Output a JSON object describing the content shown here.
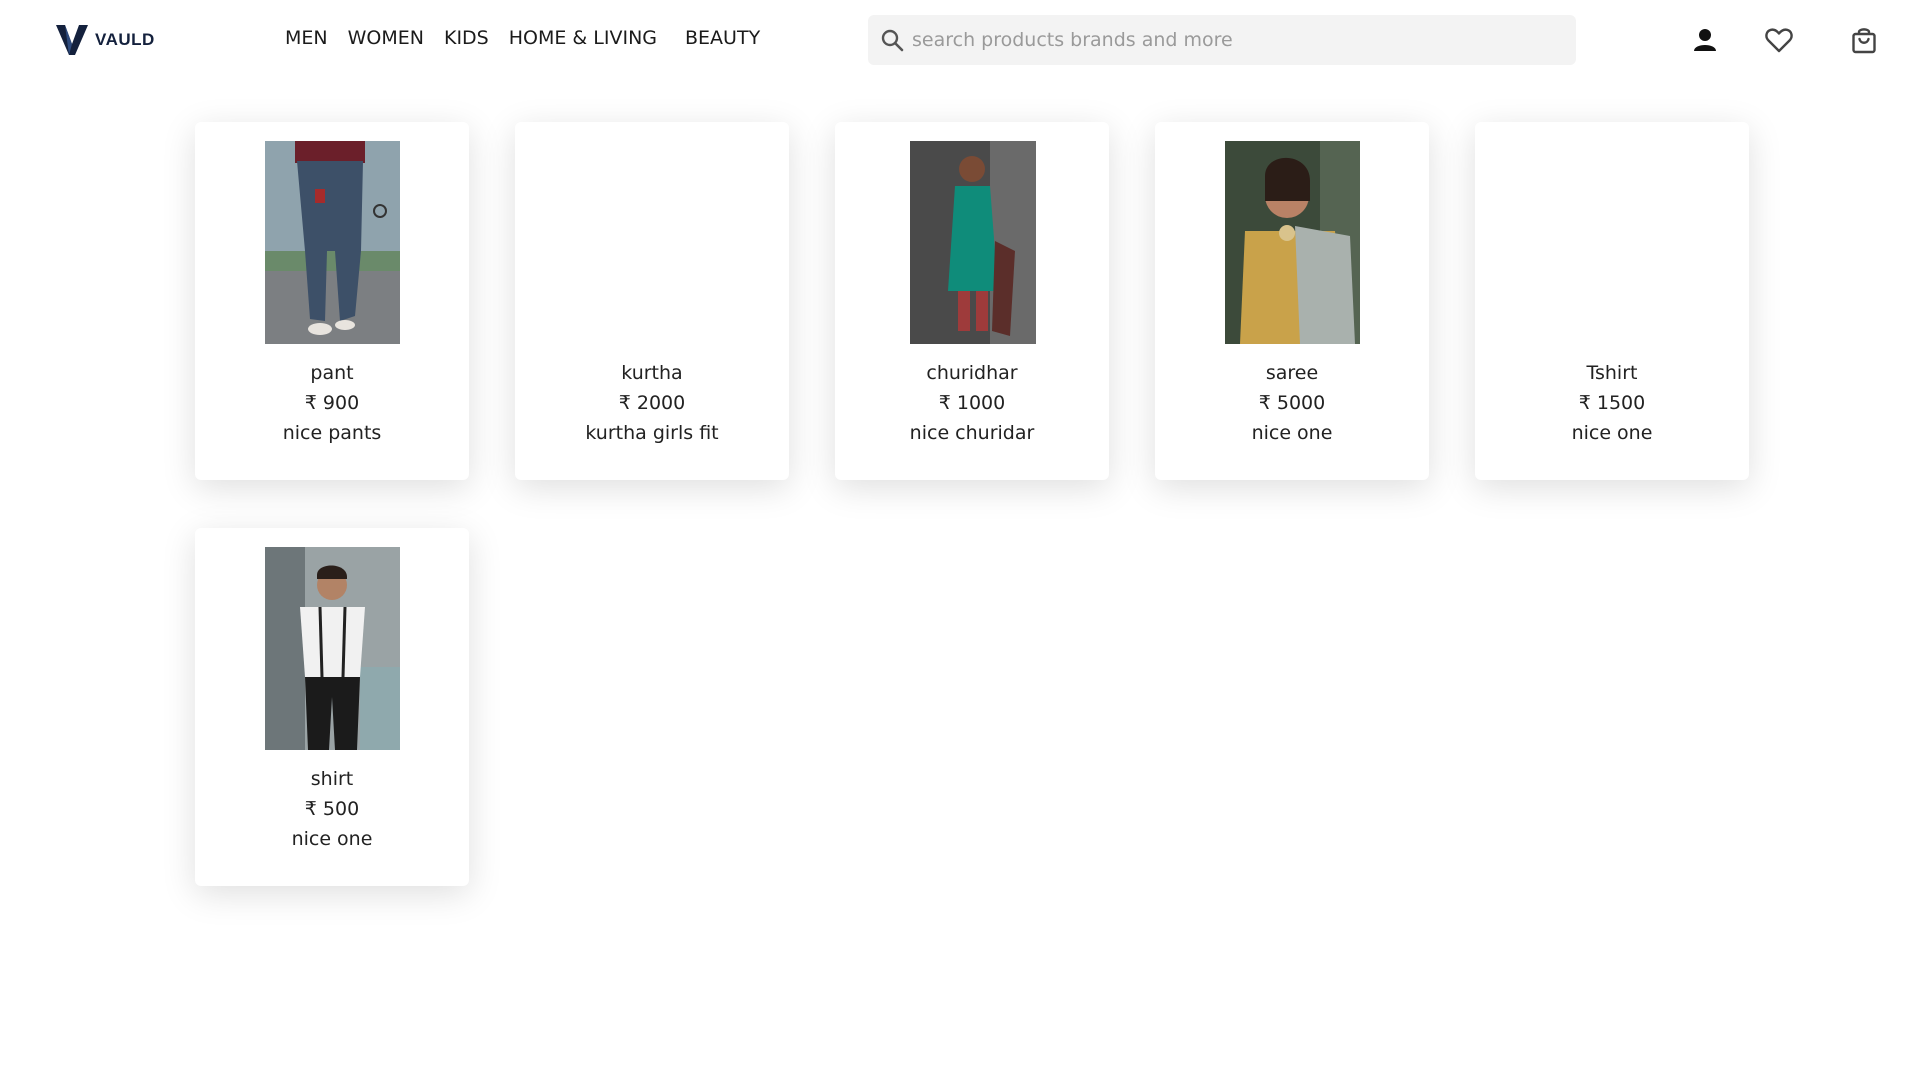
{
  "brand": {
    "name": "VAULD",
    "color": "#14213d"
  },
  "nav": [
    "MEN",
    "WOMEN",
    "KIDS",
    "HOME & LIVING",
    "BEAUTY"
  ],
  "search": {
    "placeholder": "search products brands and more",
    "value": ""
  },
  "header_icons": [
    "profile-icon",
    "wishlist-heart-icon",
    "shopping-bag-icon"
  ],
  "products": [
    {
      "name": "pant",
      "price": "₹ 900",
      "description": "nice pants",
      "has_image": true
    },
    {
      "name": "kurtha",
      "price": "₹ 2000",
      "description": "kurtha girls fit",
      "has_image": false
    },
    {
      "name": "churidhar",
      "price": "₹ 1000",
      "description": "nice churidar",
      "has_image": true
    },
    {
      "name": "saree",
      "price": "₹ 5000",
      "description": "nice one",
      "has_image": true
    },
    {
      "name": "Tshirt",
      "price": "₹ 1500",
      "description": "nice one",
      "has_image": false
    },
    {
      "name": "shirt",
      "price": "₹ 500",
      "description": "nice one",
      "has_image": true
    }
  ]
}
